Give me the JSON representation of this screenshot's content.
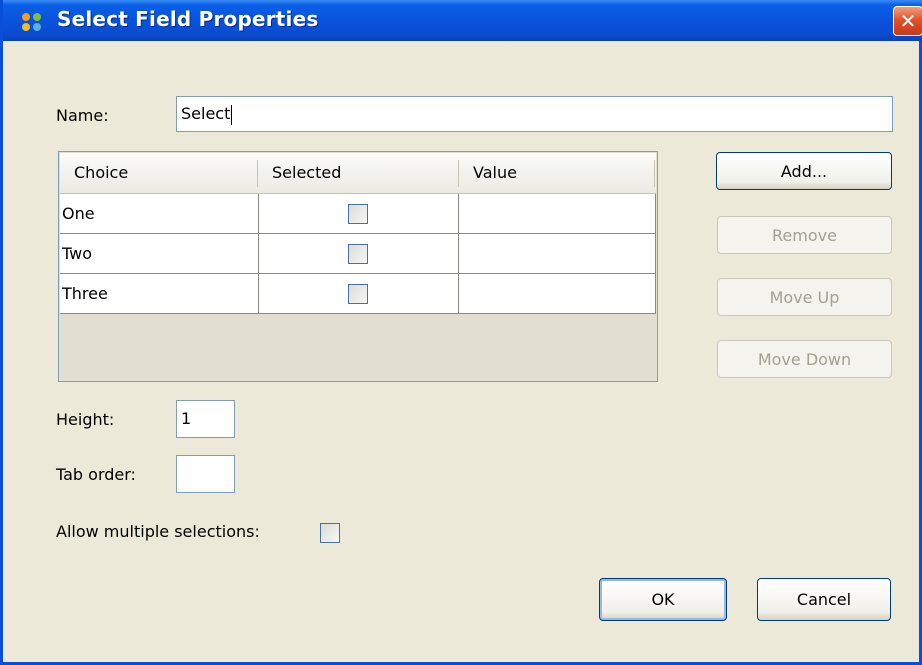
{
  "dialog": {
    "title": "Select Field Properties",
    "close_glyph": "✕"
  },
  "name_field": {
    "label": "Name:",
    "value": "Select"
  },
  "table": {
    "columns": [
      "Choice",
      "Selected",
      "Value"
    ],
    "rows": [
      {
        "choice": "One",
        "selected": false,
        "value": ""
      },
      {
        "choice": "Two",
        "selected": false,
        "value": ""
      },
      {
        "choice": "Three",
        "selected": false,
        "value": ""
      }
    ]
  },
  "side_buttons": {
    "add": "Add...",
    "remove": "Remove",
    "move_up": "Move Up",
    "move_down": "Move Down"
  },
  "height_field": {
    "label": "Height:",
    "value": "1"
  },
  "tab_order_field": {
    "label": "Tab order:",
    "value": ""
  },
  "allow_multiple": {
    "label": "Allow multiple selections:",
    "checked": false
  },
  "footer": {
    "ok": "OK",
    "cancel": "Cancel"
  },
  "colors": {
    "titlebar": "#0a53dc",
    "close": "#e0522a",
    "dialog_bg": "#ece9d8"
  }
}
